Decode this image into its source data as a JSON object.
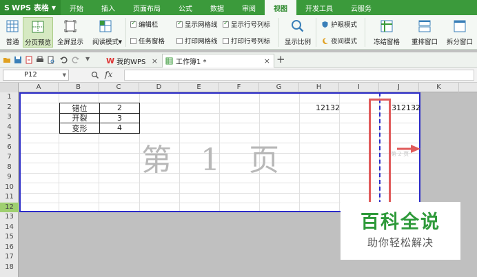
{
  "app": {
    "name": "WPS 表格",
    "logo": "S"
  },
  "menu": [
    "开始",
    "插入",
    "页面布局",
    "公式",
    "数据",
    "审阅",
    "视图",
    "开发工具",
    "云服务"
  ],
  "menu_active": "视图",
  "ribbon": {
    "normal": "普通",
    "page_break_preview": "分页预览",
    "fullscreen": "全屏显示",
    "reading_mode": "阅读模式",
    "checks": [
      {
        "label": "编辑栏",
        "checked": true
      },
      {
        "label": "任务窗格",
        "checked": false
      },
      {
        "label": "显示网格线",
        "checked": true
      },
      {
        "label": "打印网格线",
        "checked": false
      },
      {
        "label": "显示行号列标",
        "checked": true
      },
      {
        "label": "打印行号列标",
        "checked": false
      }
    ],
    "zoom": "显示比例",
    "eye_mode": "护眼模式",
    "night_mode": "夜间模式",
    "freeze": "冻结窗格",
    "arrange": "重排窗口",
    "split": "拆分窗口"
  },
  "tabs": [
    {
      "label": "我的WPS",
      "active": false
    },
    {
      "label": "工作簿1 *",
      "active": true
    }
  ],
  "name_box": "P12",
  "fx_label": "fx",
  "columns": [
    "A",
    "B",
    "C",
    "D",
    "E",
    "F",
    "G",
    "H",
    "I",
    "J",
    "K"
  ],
  "rows": [
    "1",
    "2",
    "3",
    "4",
    "5",
    "6",
    "7",
    "8",
    "9",
    "10",
    "11",
    "12",
    "13",
    "14",
    "15",
    "16",
    "17",
    "18"
  ],
  "table": [
    {
      "name": "错位",
      "value": "2"
    },
    {
      "name": "开裂",
      "value": "3"
    },
    {
      "name": "变形",
      "value": "4"
    }
  ],
  "cells": {
    "h2": "12132",
    "j2": "312132"
  },
  "watermark": "第 1 页",
  "page2_label": "第 2 页",
  "brand": {
    "title": "百科全说",
    "subtitle": "助你轻松解决"
  },
  "colors": {
    "menu_green": "#3b9a3b",
    "page_border": "#2b2bc9",
    "highlight_red": "#e05a5a",
    "brand_green": "#2e9a3a"
  }
}
